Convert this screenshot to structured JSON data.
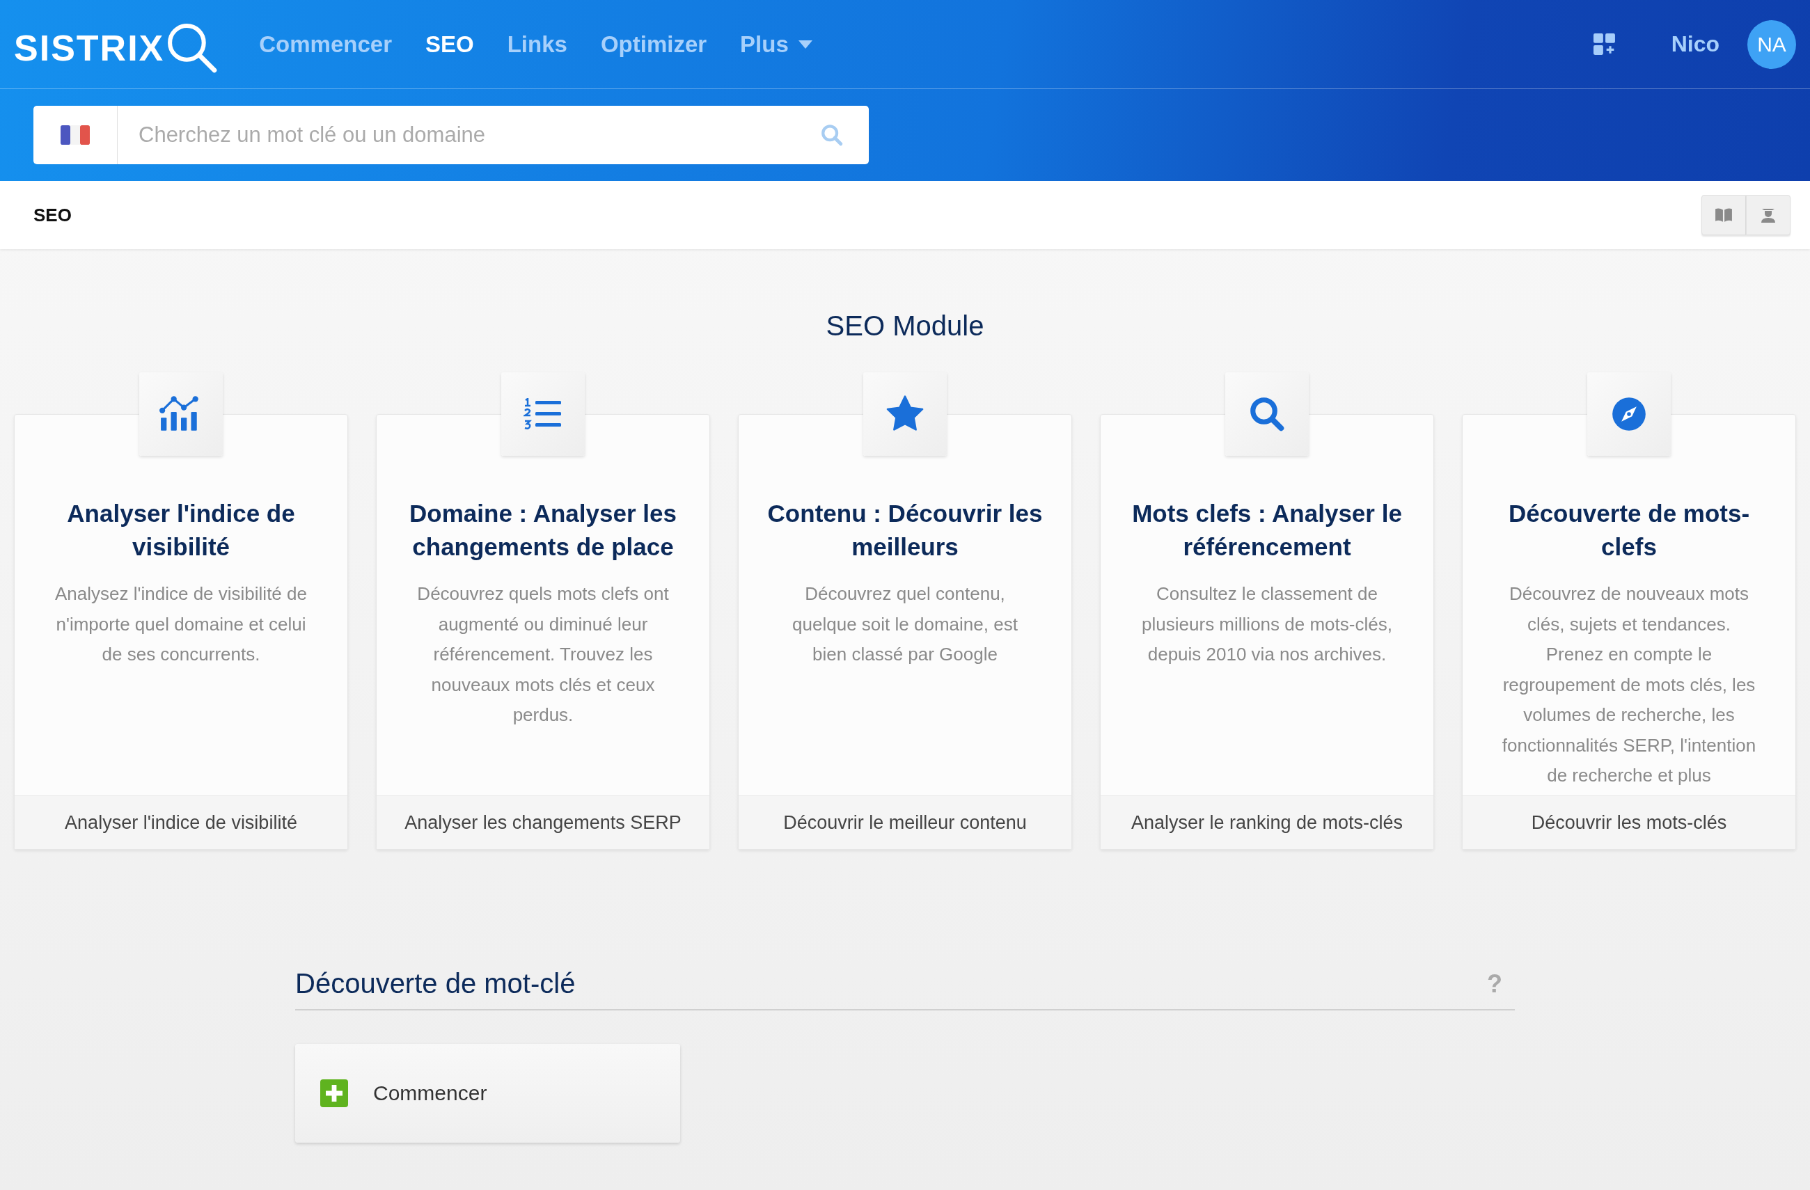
{
  "header": {
    "logo": "SISTRIX",
    "nav": [
      {
        "label": "Commencer",
        "selected": false,
        "dropdown": false
      },
      {
        "label": "SEO",
        "selected": true,
        "dropdown": false
      },
      {
        "label": "Links",
        "selected": false,
        "dropdown": false
      },
      {
        "label": "Optimizer",
        "selected": false,
        "dropdown": false
      },
      {
        "label": "Plus",
        "selected": false,
        "dropdown": true
      }
    ],
    "user_name": "Nico",
    "avatar_initials": "NA"
  },
  "search": {
    "placeholder": "Cherchez un mot clé ou un domaine"
  },
  "breadcrumb": "SEO",
  "section_title": "SEO Module",
  "modules": [
    {
      "kind": "chart",
      "title": "Analyser l'indice de visibilité",
      "description": "Analysez l'indice de visibilité de n'importe quel domaine et celui de ses concurrents.",
      "action": "Analyser l'indice de visibilité"
    },
    {
      "kind": "list",
      "title": "Domaine : Analyser les changements de place",
      "description": "Découvrez quels mots clefs ont augmenté ou diminué leur référencement. Trouvez les nouveaux mots clés et ceux perdus.",
      "action": "Analyser les changements SERP"
    },
    {
      "kind": "star",
      "title": "Contenu : Découvrir les meilleurs",
      "description": "Découvrez quel contenu, quelque soit le domaine, est bien classé par Google",
      "action": "Découvrir le meilleur contenu"
    },
    {
      "kind": "search",
      "title": "Mots clefs : Analyser le référencement",
      "description": "Consultez le classement de plusieurs millions de mots-clés, depuis 2010 via nos archives.",
      "action": "Analyser le ranking de mots-clés"
    },
    {
      "kind": "compass",
      "title": "Découverte de mots-clefs",
      "description": "Découvrez de nouveaux mots clés, sujets et tendances. Prenez en compte le regroupement de mots clés, les volumes de recherche, les fonctionnalités SERP, l'intention de recherche et plus",
      "action": "Découvrir les mots-clés"
    }
  ],
  "discovery": {
    "title": "Découverte de mot-clé",
    "help": "?",
    "start_button": "Commencer"
  }
}
